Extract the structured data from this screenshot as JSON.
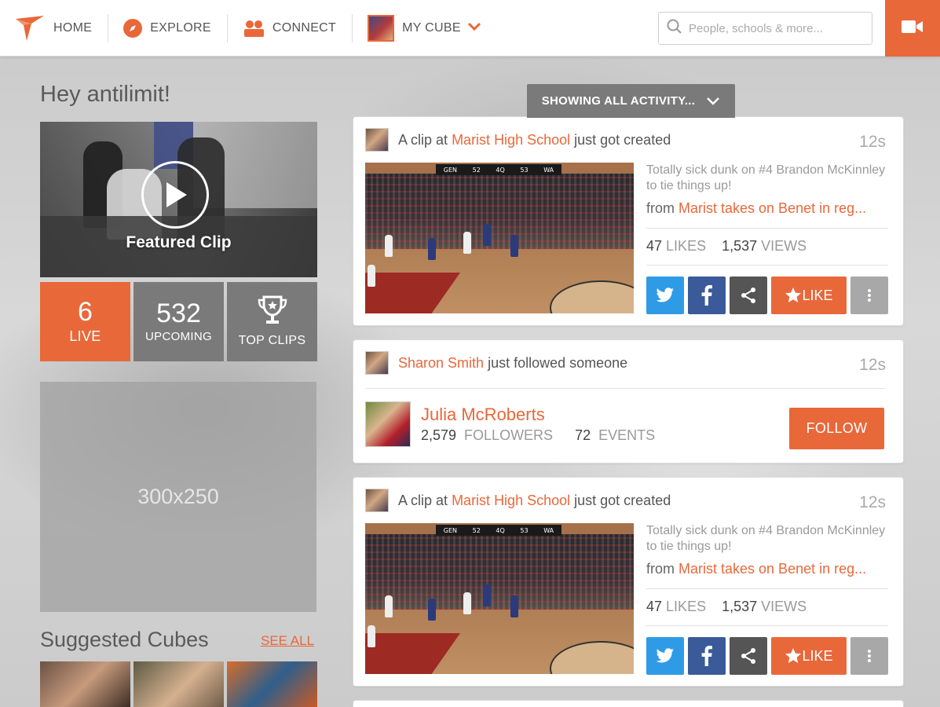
{
  "nav": {
    "home_label": "HOME",
    "explore_label": "EXPLORE",
    "connect_label": "CONNECT",
    "mycube_label": "MY CUBE",
    "search_placeholder": "People, schools & more..."
  },
  "sidebar": {
    "greeting": "Hey antilimit!",
    "featured_label": "Featured Clip",
    "stats": [
      {
        "value": "6",
        "label": "LIVE"
      },
      {
        "value": "532",
        "label": "UPCOMING"
      },
      {
        "value": "",
        "label": "TOP CLIPS"
      }
    ],
    "ad_label": "300x250",
    "suggested_title": "Suggested Cubes",
    "see_all": "SEE ALL"
  },
  "feed": {
    "filter_label": "SHOWING ALL ACTIVITY...",
    "cards": [
      {
        "pre": "A clip at",
        "link": "Marist High School",
        "post": "just got created",
        "time": "12s",
        "description": "Totally sick dunk on #4 Brandon McKinnley to tie things up!",
        "from_prefix": "from",
        "from_link": "Marist takes on Benet in reg...",
        "likes": "47",
        "likes_label": "LIKES",
        "views": "1,537",
        "views_label": "VIEWS",
        "like_button": "LIKE",
        "scoreboard": [
          "GEN",
          "52",
          "4Q",
          "53",
          "WA"
        ]
      },
      {
        "user": "Sharon Smith",
        "action": "just followed someone",
        "time": "12s",
        "followed_name": "Julia McRoberts",
        "followers": "2,579",
        "followers_label": "FOLLOWERS",
        "events": "72",
        "events_label": "EVENTS",
        "follow_button": "FOLLOW"
      },
      {
        "pre": "A clip at",
        "link": "Marist High School",
        "post": "just got created",
        "time": "12s",
        "description": "Totally sick dunk on #4 Brandon McKinnley to tie things up!",
        "from_prefix": "from",
        "from_link": "Marist takes on Benet in reg...",
        "likes": "47",
        "likes_label": "LIKES",
        "views": "1,537",
        "views_label": "VIEWS",
        "like_button": "LIKE",
        "scoreboard": [
          "GEN",
          "52",
          "4Q",
          "53",
          "WA"
        ]
      }
    ]
  },
  "colors": {
    "accent": "#e8683a",
    "twitter": "#2f9be6",
    "facebook": "#3a5a9a",
    "tile_gray": "#7a7a7a"
  },
  "icons": {
    "logo": "brand-logo-icon",
    "explore": "compass-icon",
    "connect": "people-icon",
    "search": "search-icon",
    "video": "video-camera-icon"
  }
}
